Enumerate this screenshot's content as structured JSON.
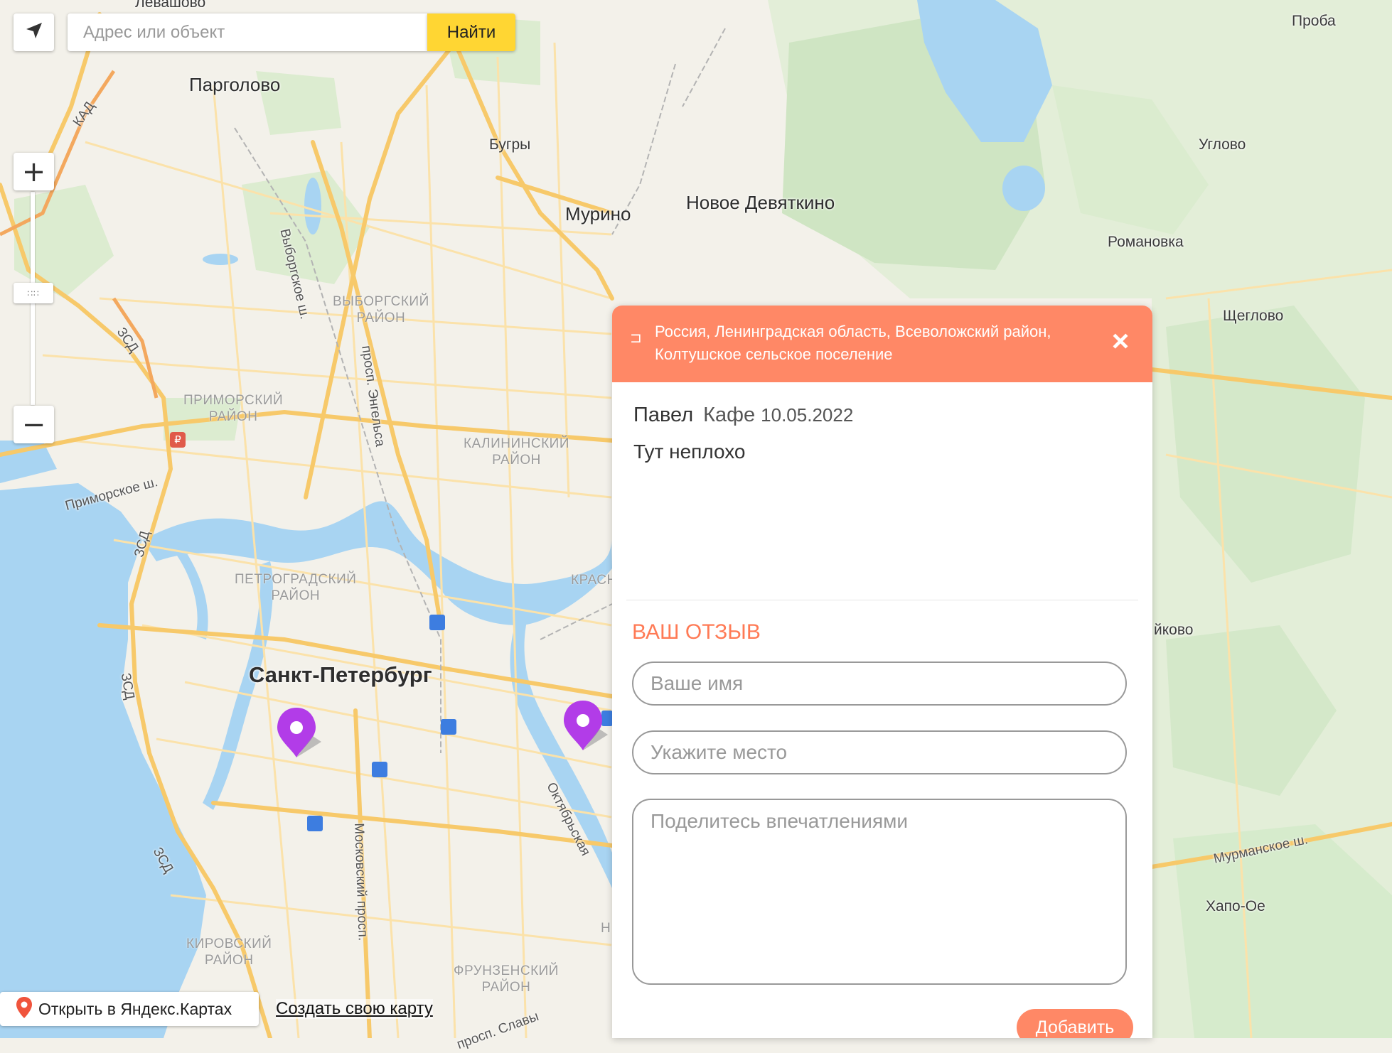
{
  "search": {
    "placeholder": "Адрес или объект",
    "button_label": "Найти"
  },
  "zoom": {
    "in_label": "+",
    "out_label": "−",
    "handle_label": "∷∷"
  },
  "map_labels": {
    "levashovo": "Левашово",
    "pargolovo": "Парголово",
    "bugry": "Бугры",
    "murino": "Мурино",
    "novoe_devyatkino": "Новое Девяткино",
    "proba": "Проба",
    "uglovo": "Углово",
    "romanovka": "Романовка",
    "shcheglovo": "Щеглово",
    "ikovo": "йково",
    "khapo_oe": "Хапо-Ое",
    "spb": "Санкт-Петербург",
    "vyborgsky": "ВЫБОРГСКИЙ\nРАЙОН",
    "primorsky": "ПРИМОРСКИЙ\nРАЙОН",
    "kalininsky": "КАЛИНИНСКИЙ\nРАЙОН",
    "petrogradsky": "ПЕТРОГРАДСКИЙ\nРАЙОН",
    "kirovsky": "КИРОВСКИЙ\nРАЙОН",
    "frunzensky": "ФРУНЗЕНСКИЙ\nРАЙОН",
    "krasn_partial": "КРАСН",
    "n_partial": "Н",
    "kad": "КАД",
    "zsd": "ЗСД",
    "vyborgskoe_sh": "Выборгское ш.",
    "engelsa": "просп. Энгельса",
    "primorskoe_sh": "Приморское ш.",
    "moskovsky": "Московский просп.",
    "oktyabrskaya": "Октябрьская",
    "murmanskoe": "Мурманское ш.",
    "slavy": "просп. Славы"
  },
  "bottom": {
    "open_yandex": "Открыть в Яндекс.Картах",
    "create_map": "Создать свою карту"
  },
  "panel": {
    "address": "Россия, Ленинградская область, Всеволожский район, Колтушское сельское поселение",
    "close_label": "×",
    "review": {
      "author": "Павел",
      "place": "Кафе",
      "date": "10.05.2022",
      "text": "Тут неплохо"
    },
    "form": {
      "title": "ВАШ ОТЗЫВ",
      "name_placeholder": "Ваше имя",
      "place_placeholder": "Укажите место",
      "impressions_placeholder": "Поделитесь впечатлениями",
      "submit_label": "Добавить"
    }
  },
  "colors": {
    "panel_header": "#ff8866",
    "accent_title": "#ff7a55",
    "search_button": "#ffd633",
    "water": "#a8d4f2",
    "park": "#d6ebcc",
    "road_major": "#f9c96b",
    "marker": "#b23ce8"
  }
}
